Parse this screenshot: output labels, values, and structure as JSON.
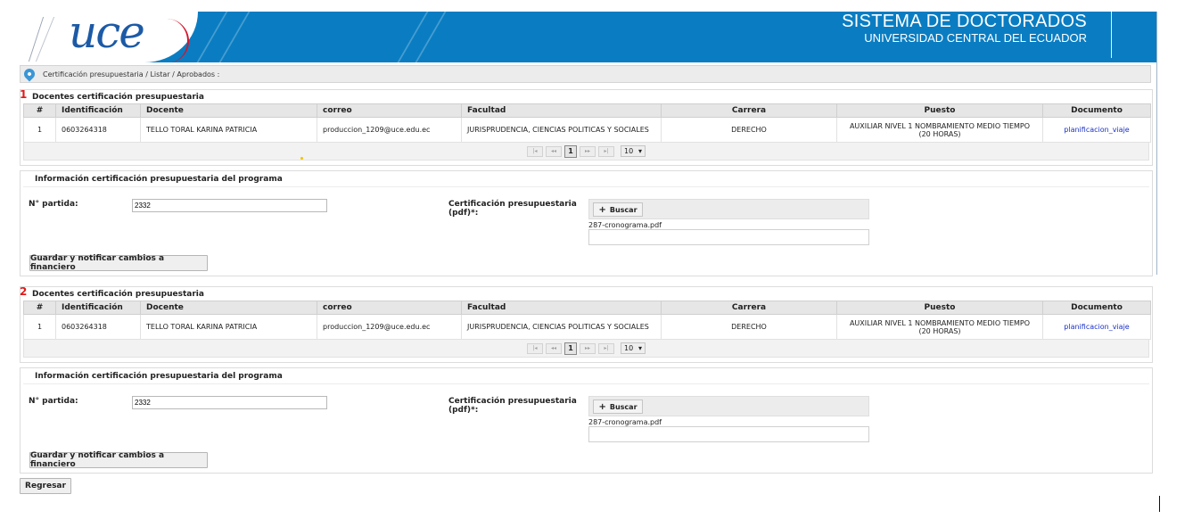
{
  "header": {
    "logo_text": "uce",
    "title": "SISTEMA DE DOCTORADOS",
    "subtitle": "UNIVERSIDAD CENTRAL DEL ECUADOR"
  },
  "breadcrumb": {
    "icon": "location-pin-icon",
    "text": "Certificación presupuestaria / Listar / Aprobados :"
  },
  "sections": [
    {
      "number": "1",
      "title": "Docentes certificación presupuestaria",
      "columns": [
        "#",
        "Identificación",
        "Docente",
        "correo",
        "Facultad",
        "Carrera",
        "Puesto",
        "Documento"
      ],
      "rows": [
        {
          "num": "1",
          "id": "0603264318",
          "docente": "TELLO TORAL KARINA PATRICIA",
          "correo": "produccion_1209@uce.edu.ec",
          "facultad": "JURISPRUDENCIA, CIENCIAS POLITICAS Y SOCIALES",
          "carrera": "DERECHO",
          "puesto_1": "AUXILIAR NIVEL 1 NOMBRAMIENTO MEDIO TIEMPO",
          "puesto_2": "(20 HORAS)",
          "documento": "planificacion_viaje"
        }
      ],
      "paginator": {
        "first": "|◂",
        "prev": "◂◂",
        "page": "1",
        "next": "▸▸",
        "last": "▸|",
        "rows_per_page": "10"
      },
      "form": {
        "title": "Información certificación presupuestaria del programa",
        "partida_label": "N° partida:",
        "partida_value": "2332",
        "cert_label_1": "Certificación presupuestaria",
        "cert_label_2": "(pdf)*:",
        "buscar_label": "Buscar",
        "filename": "287-cronograma.pdf",
        "save_label": "Guardar y notificar cambios a financiero"
      }
    },
    {
      "number": "2",
      "title": "Docentes certificación presupuestaria",
      "columns": [
        "#",
        "Identificación",
        "Docente",
        "correo",
        "Facultad",
        "Carrera",
        "Puesto",
        "Documento"
      ],
      "rows": [
        {
          "num": "1",
          "id": "0603264318",
          "docente": "TELLO TORAL KARINA PATRICIA",
          "correo": "produccion_1209@uce.edu.ec",
          "facultad": "JURISPRUDENCIA, CIENCIAS POLITICAS Y SOCIALES",
          "carrera": "DERECHO",
          "puesto_1": "AUXILIAR NIVEL 1 NOMBRAMIENTO MEDIO TIEMPO",
          "puesto_2": "(20 HORAS)",
          "documento": "planificacion_viaje"
        }
      ],
      "paginator": {
        "first": "|◂",
        "prev": "◂◂",
        "page": "1",
        "next": "▸▸",
        "last": "▸|",
        "rows_per_page": "10"
      },
      "form": {
        "title": "Información certificación presupuestaria del programa",
        "partida_label": "N° partida:",
        "partida_value": "2332",
        "cert_label_1": "Certificación presupuestaria",
        "cert_label_2": "(pdf)*:",
        "buscar_label": "Buscar",
        "filename": "287-cronograma.pdf",
        "save_label": "Guardar y notificar cambios a financiero"
      }
    }
  ],
  "back_label": "Regresar",
  "colors": {
    "header_blue": "#0a7dc2",
    "logo_blue": "#1c5aa6",
    "number_red": "#e01a1a",
    "link_blue": "#1a31c7"
  }
}
